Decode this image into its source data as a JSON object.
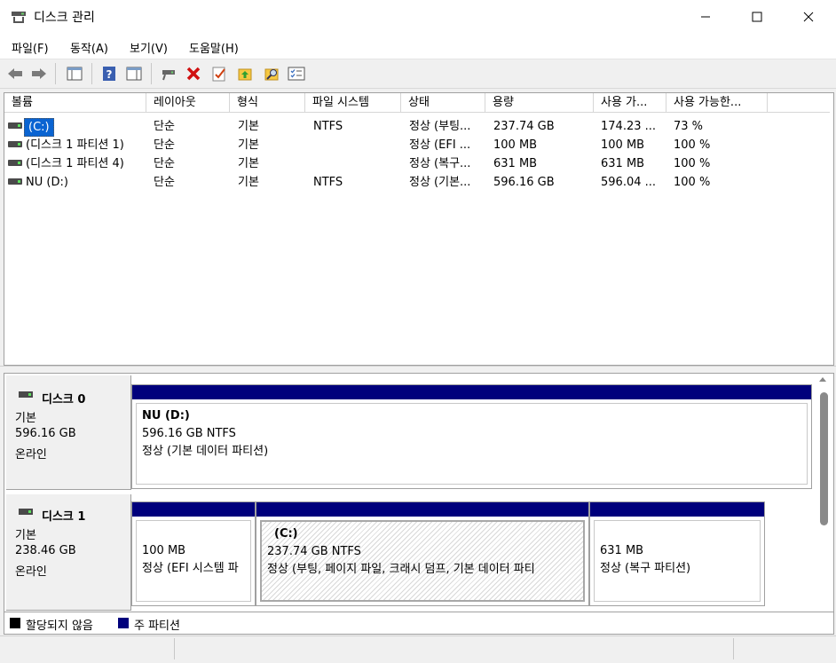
{
  "window": {
    "title": "디스크 관리"
  },
  "menu": [
    {
      "label": "파일(F)"
    },
    {
      "label": "동작(A)"
    },
    {
      "label": "보기(V)"
    },
    {
      "label": "도움말(H)"
    }
  ],
  "toolbar": {
    "icons": [
      "back-icon",
      "forward-icon",
      "console-tree-icon",
      "help-icon",
      "properties-pane-icon",
      "connect-disk-icon",
      "delete-icon",
      "check-icon",
      "up-folder-icon",
      "search-icon",
      "settings-list-icon"
    ]
  },
  "volume_list": {
    "columns": [
      "볼륨",
      "레이아웃",
      "형식",
      "파일 시스템",
      "상태",
      "용량",
      "사용 가...",
      "사용 가능한..."
    ],
    "rows": [
      {
        "volume": "(C:)",
        "layout": "단순",
        "type": "기본",
        "fs": "NTFS",
        "status": "정상 (부팅...",
        "capacity": "237.74 GB",
        "free": "174.23 ...",
        "free_pct": "73 %"
      },
      {
        "volume": "(디스크 1 파티션 1)",
        "layout": "단순",
        "type": "기본",
        "fs": "",
        "status": "정상 (EFI ...",
        "capacity": "100 MB",
        "free": "100 MB",
        "free_pct": "100 %"
      },
      {
        "volume": "(디스크 1 파티션 4)",
        "layout": "단순",
        "type": "기본",
        "fs": "",
        "status": "정상 (복구...",
        "capacity": "631 MB",
        "free": "631 MB",
        "free_pct": "100 %"
      },
      {
        "volume": "NU (D:)",
        "layout": "단순",
        "type": "기본",
        "fs": "NTFS",
        "status": "정상 (기본...",
        "capacity": "596.16 GB",
        "free": "596.04 ...",
        "free_pct": "100 %"
      }
    ]
  },
  "disks": [
    {
      "name": "디스크 0",
      "type": "기본",
      "size": "596.16 GB",
      "state": "온라인",
      "partitions": [
        {
          "title": "NU  (D:)",
          "size": "596.16 GB NTFS",
          "status": "정상 (기본 데이터 파티션)"
        }
      ]
    },
    {
      "name": "디스크 1",
      "type": "기본",
      "size": "238.46 GB",
      "state": "온라인",
      "partitions": [
        {
          "title": "",
          "size": "100 MB",
          "status": "정상 (EFI 시스템 파"
        },
        {
          "title": "(C:)",
          "size": "237.74 GB NTFS",
          "status": "정상 (부팅, 페이지 파일, 크래시 덤프, 기본 데이터 파티"
        },
        {
          "title": "",
          "size": "631 MB",
          "status": "정상 (복구 파티션)"
        }
      ]
    }
  ],
  "legend": [
    {
      "label": "할당되지 않음",
      "color": "#000000"
    },
    {
      "label": "주 파티션",
      "color": "#00007c"
    }
  ]
}
